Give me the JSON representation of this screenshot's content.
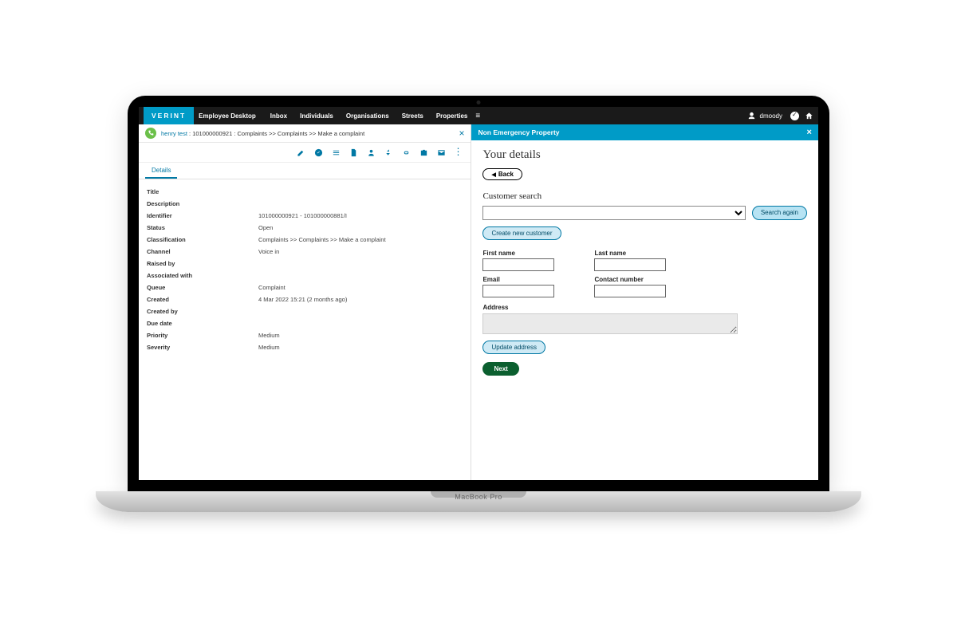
{
  "brand": "VERINT",
  "app_name": "Employee Desktop",
  "nav": {
    "inbox": "Inbox",
    "individuals": "Individuals",
    "organisations": "Organisations",
    "streets": "Streets",
    "properties": "Properties"
  },
  "username": "dmoody",
  "left": {
    "breadcrumb_name": "henry test",
    "breadcrumb_rest": " : 101000000921 : Complaints >> Complaints >> Make a complaint",
    "tab_details": "Details",
    "rows": {
      "title_label": "Title",
      "title_val": "",
      "description_label": "Description",
      "description_val": "",
      "identifier_label": "Identifier",
      "identifier_val": "101000000921 - 101000000881/I",
      "status_label": "Status",
      "status_val": "Open",
      "classification_label": "Classification",
      "classification_val": "Complaints >> Complaints >> Make a complaint",
      "channel_label": "Channel",
      "channel_val": "Voice in",
      "raisedby_label": "Raised by",
      "raisedby_val": "",
      "associated_label": "Associated with",
      "associated_val": "",
      "queue_label": "Queue",
      "queue_val": "Complaint",
      "created_label": "Created",
      "created_val": "4 Mar 2022 15:21 (2 months ago)",
      "createdby_label": "Created by",
      "createdby_val": "",
      "duedate_label": "Due date",
      "duedate_val": "",
      "priority_label": "Priority",
      "priority_val": "Medium",
      "severity_label": "Severity",
      "severity_val": "Medium"
    }
  },
  "right": {
    "header": "Non Emergency Property",
    "heading": "Your details",
    "back": "Back",
    "customer_search": "Customer search",
    "search_again": "Search again",
    "create_new_customer": "Create new customer",
    "first_name": "First name",
    "last_name": "Last name",
    "email": "Email",
    "contact_number": "Contact number",
    "address": "Address",
    "update_address": "Update address",
    "next": "Next"
  },
  "laptop_label": "MacBook Pro"
}
